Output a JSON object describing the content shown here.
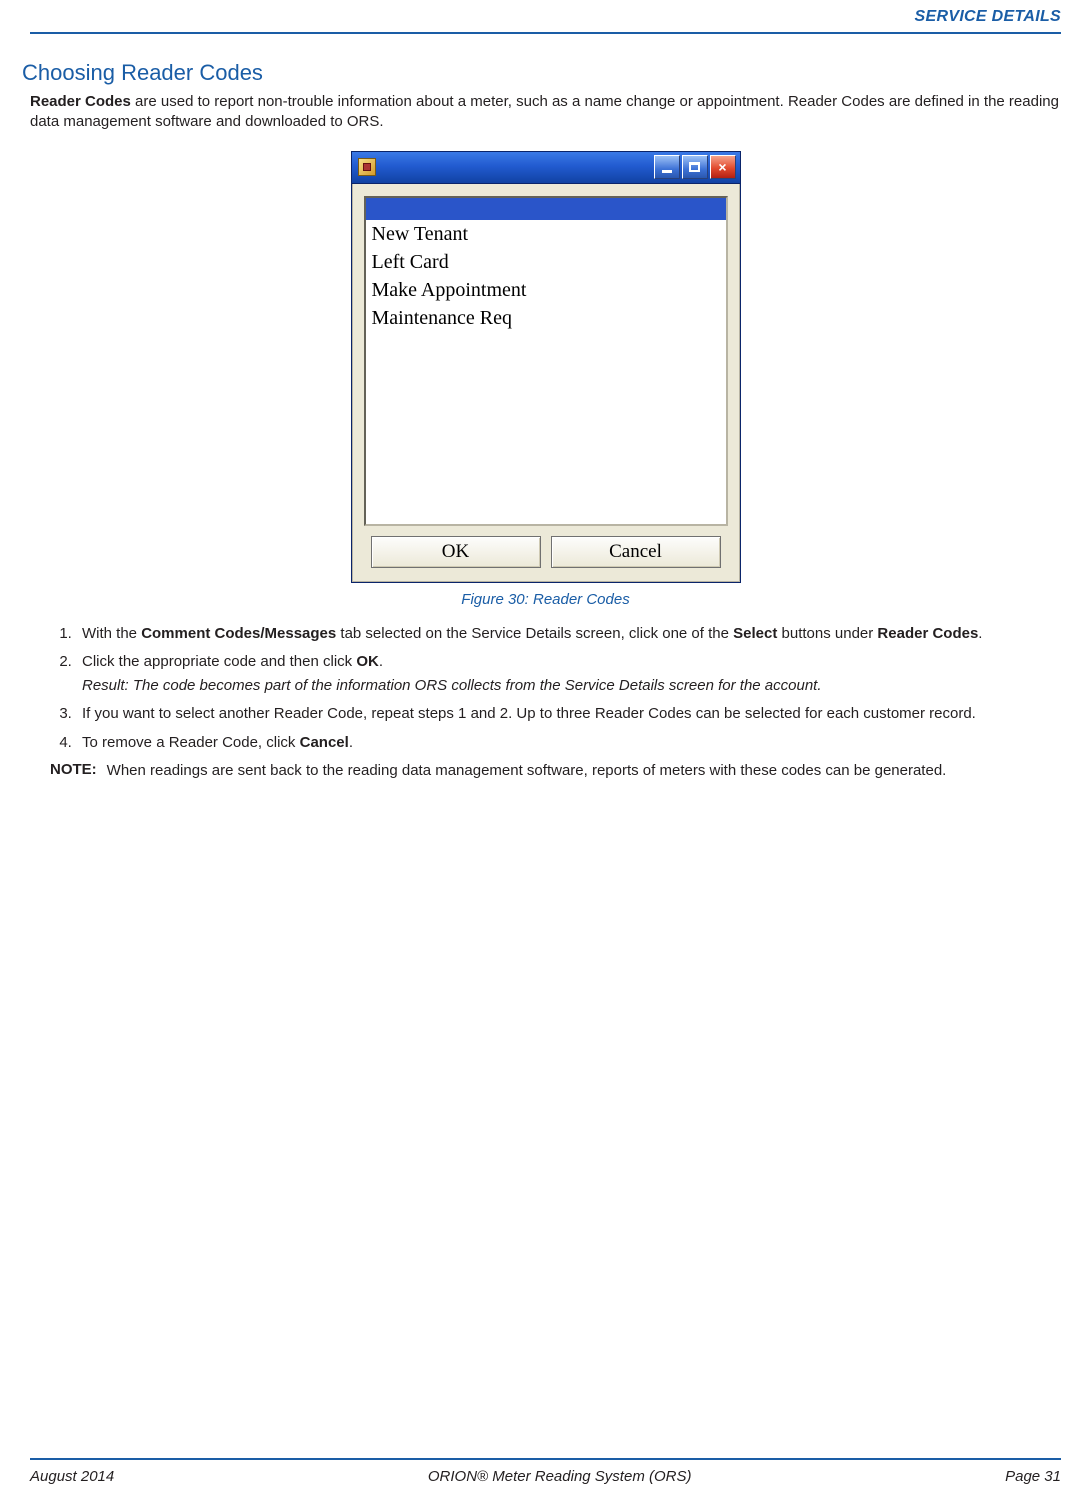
{
  "header": {
    "running_head": "SERVICE DETAILS"
  },
  "section": {
    "title": "Choosing Reader Codes",
    "intro_lead": "Reader Codes",
    "intro_rest": " are used to report non-trouble information about a meter, such as a name change or appointment. Reader Codes are defined in the reading data management software and downloaded to ORS."
  },
  "dialog": {
    "items": [
      "",
      "New Tenant",
      "Left Card",
      "Make Appointment",
      "Maintenance Req"
    ],
    "ok_label": "OK",
    "cancel_label": "Cancel"
  },
  "figure": {
    "caption": "Figure 30:  Reader Codes"
  },
  "steps": {
    "s1_a": "With the ",
    "s1_b1": "Comment Codes/Messages",
    "s1_c": " tab selected on the Service Details screen, click one of the ",
    "s1_b2": "Select",
    "s1_d": " buttons under ",
    "s1_b3": "Reader Codes",
    "s1_e": ".",
    "s2_a": "Click the appropriate code and then click ",
    "s2_b": "OK",
    "s2_c": ".",
    "s2_result": "Result: The code becomes part of the information ORS collects from the Service Details screen for the account.",
    "s3": "If you want to select another Reader Code, repeat steps 1 and 2. Up to three Reader Codes can be selected for each customer record.",
    "s4_a": "To remove a Reader Code, click ",
    "s4_b": "Cancel",
    "s4_c": "."
  },
  "note": {
    "label": "NOTE:",
    "text": "When readings are sent back to the reading data management software, reports of meters with these codes can be generated."
  },
  "footer": {
    "left": "August 2014",
    "center": "ORION® Meter Reading System (ORS)",
    "right": "Page 31"
  }
}
